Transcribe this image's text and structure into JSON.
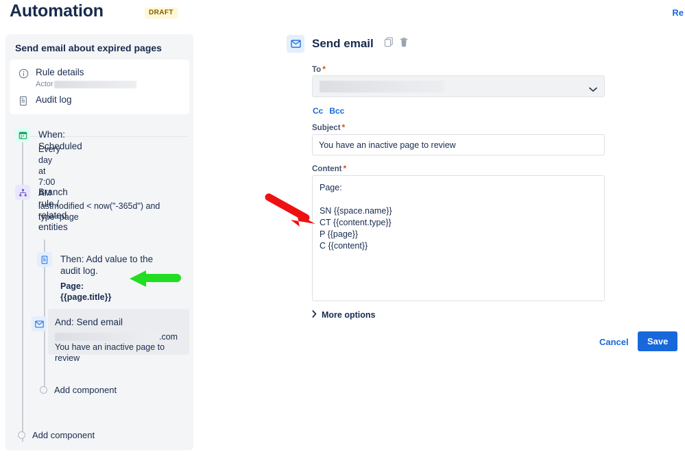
{
  "header": {
    "title": "Automation",
    "badge": "DRAFT",
    "right_link": "Re"
  },
  "sidebar": {
    "title": "Send email about expired pages",
    "card_items": [
      {
        "label": "Rule details",
        "icon": "info-circle-icon",
        "sub_label": "Actor",
        "sub_redacted": true
      },
      {
        "label": "Audit log",
        "icon": "audit-log-icon"
      }
    ],
    "nodes": [
      {
        "title": "When: Scheduled",
        "subtitle": "Every day at 7:00 AM",
        "icon": "calendar-icon",
        "icon_color": "#22a06b",
        "icon_bg": "#dcfff1"
      },
      {
        "title": "Branch rule / related entities",
        "subtitle": "lastmodified < now(\"-365d\") and\ntype=page",
        "icon": "branch-icon",
        "icon_color": "#6e5dc6",
        "icon_bg": "#eae6ff"
      },
      {
        "title": "Then: Add value to the\naudit log.",
        "subtitle": "Page: {{page.title}}",
        "icon": "document-icon",
        "icon_color": "#1868db",
        "icon_bg": "#e3effd"
      },
      {
        "title": "And: Send email",
        "subtitle_redacted": true,
        "subtitle_suffix": ".com",
        "subtitle2": "You have an inactive page to review",
        "icon": "envelope-icon",
        "icon_color": "#1868db",
        "icon_bg": "#e3effd",
        "selected": true
      }
    ],
    "add_component_inner": "Add component",
    "add_component_outer": "Add component"
  },
  "detail": {
    "icon": "envelope-icon",
    "title": "Send email",
    "actions": [
      {
        "name": "copy-icon"
      },
      {
        "name": "delete-icon"
      }
    ],
    "fields": {
      "to": {
        "label": "To",
        "required": true,
        "value_redacted": true
      },
      "cc": "Cc",
      "bcc": "Bcc",
      "subject": {
        "label": "Subject",
        "required": true,
        "value": "You have an inactive page to review"
      },
      "content": {
        "label": "Content",
        "required": true,
        "value": "Page:\n\nSN {{space.name}}\nCT {{content.type}}\nP {{page}}\nC {{content}}"
      }
    },
    "more_options": "More options",
    "cancel_label": "Cancel",
    "save_label": "Save"
  },
  "annotations": [
    {
      "name": "red-arrow",
      "color": "#ee1111",
      "direction": "down-right"
    },
    {
      "name": "green-arrow",
      "color": "#22dd22",
      "direction": "left"
    }
  ],
  "colors": {
    "accent": "#1868db",
    "panel_bg": "#f4f5f7",
    "text": "#172b4d"
  }
}
